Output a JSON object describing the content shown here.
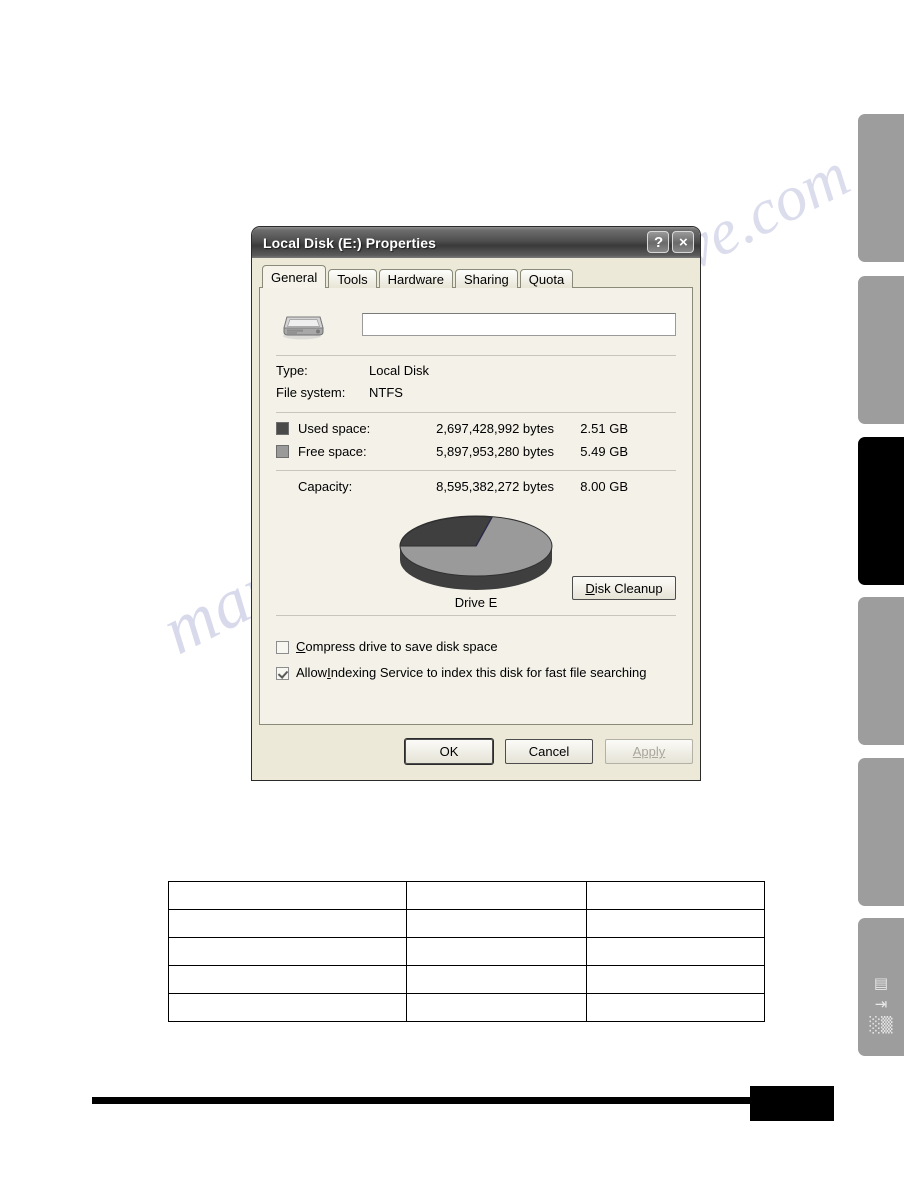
{
  "dialog": {
    "title": "Local Disk (E:) Properties",
    "title_buttons": [
      {
        "name": "help-button",
        "glyph": "?"
      },
      {
        "name": "close-button",
        "glyph": "×"
      }
    ],
    "tabs": [
      {
        "label": "General",
        "active": true
      },
      {
        "label": "Tools",
        "active": false
      },
      {
        "label": "Hardware",
        "active": false
      },
      {
        "label": "Sharing",
        "active": false
      },
      {
        "label": "Quota",
        "active": false
      }
    ],
    "volume_label": {
      "value": "",
      "placeholder": ""
    },
    "info": [
      {
        "key": "Type:",
        "value": "Local Disk"
      },
      {
        "key": "File system:",
        "value": "NTFS"
      }
    ],
    "space": [
      {
        "label": "Used space:",
        "bytes": "2,697,428,992 bytes",
        "size": "2.51 GB",
        "color": "#4a4a4a"
      },
      {
        "label": "Free space:",
        "bytes": "5,897,953,280 bytes",
        "size": "5.49 GB",
        "color": "#9a9a9a"
      }
    ],
    "capacity": {
      "label": "Capacity:",
      "bytes": "8,595,382,272 bytes",
      "size": "8.00 GB"
    },
    "drive_caption": "Drive E",
    "cleanup_button": {
      "accel": "D",
      "rest": "isk Cleanup"
    },
    "checkboxes": [
      {
        "accel": "C",
        "before": "",
        "rest": "ompress drive to save disk space",
        "checked": false
      },
      {
        "accel": "I",
        "before": "Allow ",
        "rest": "ndexing Service to index this disk for fast file searching",
        "checked": true
      }
    ],
    "buttons": [
      {
        "label": "OK",
        "state": "default"
      },
      {
        "label": "Cancel",
        "state": "normal"
      },
      {
        "label": "Apply",
        "state": "disabled"
      }
    ]
  },
  "page": {
    "watermark": "manualshive.com",
    "watermark2": "manualshive.com",
    "side_tabs": [
      {
        "active": false
      },
      {
        "active": false
      },
      {
        "active": true
      },
      {
        "active": false
      },
      {
        "active": false
      },
      {
        "active": false
      }
    ],
    "side_tab_glyphs": "空\n斗\n嘴",
    "table": {
      "rows": [
        [
          "",
          "",
          ""
        ],
        [
          "",
          "",
          ""
        ],
        [
          "",
          "",
          ""
        ],
        [
          "",
          "",
          ""
        ],
        [
          "",
          "",
          ""
        ]
      ]
    },
    "footer_page_number": ""
  },
  "chart_data": {
    "type": "pie",
    "title": "Drive E",
    "categories": [
      "Used space",
      "Free space"
    ],
    "values": [
      2697428992,
      5897953280
    ],
    "percentages": [
      31.4,
      68.6
    ],
    "labels": [
      "2.51 GB",
      "5.49 GB"
    ],
    "colors": [
      "#4a4a4a",
      "#9a9a9a"
    ],
    "total": 8595382272,
    "total_label": "8.00 GB",
    "legend_position": "above",
    "style": "3d-pie"
  }
}
